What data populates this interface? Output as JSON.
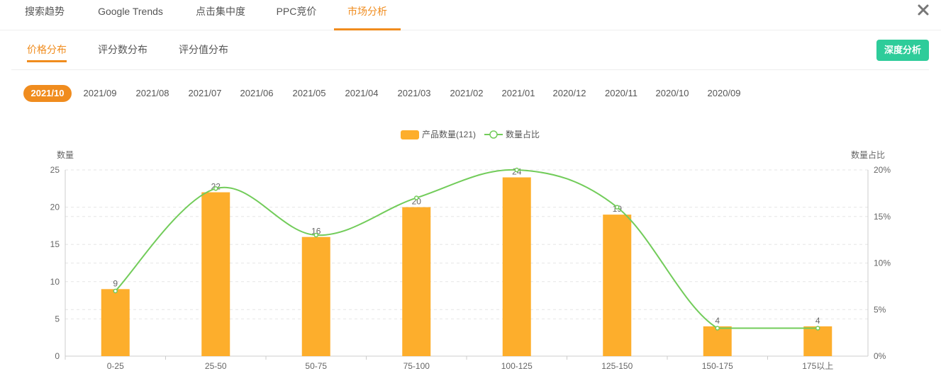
{
  "top_tabs": [
    {
      "label": "搜索趋势",
      "active": false
    },
    {
      "label": "Google Trends",
      "active": false
    },
    {
      "label": "点击集中度",
      "active": false
    },
    {
      "label": "PPC竞价",
      "active": false
    },
    {
      "label": "市场分析",
      "active": true
    }
  ],
  "close_icon": "close-icon",
  "sub_tabs": [
    {
      "label": "价格分布",
      "active": true
    },
    {
      "label": "评分数分布",
      "active": false
    },
    {
      "label": "评分值分布",
      "active": false
    }
  ],
  "deep_button": "深度分析",
  "months": [
    "2021/10",
    "2021/09",
    "2021/08",
    "2021/07",
    "2021/06",
    "2021/05",
    "2021/04",
    "2021/03",
    "2021/02",
    "2021/01",
    "2020/12",
    "2020/11",
    "2020/10",
    "2020/09"
  ],
  "active_month": "2021/10",
  "colors": {
    "accent": "#f08c1e",
    "bar": "#fdae2c",
    "line": "#72cc5a",
    "button": "#2ecc9a"
  },
  "chart_data": {
    "type": "bar",
    "categories": [
      "0-25",
      "25-50",
      "50-75",
      "75-100",
      "100-125",
      "125-150",
      "150-175",
      "175以上"
    ],
    "series": [
      {
        "name": "产品数量(121)",
        "type": "bar",
        "axis": "left",
        "values": [
          9,
          22,
          16,
          20,
          24,
          19,
          4,
          4
        ]
      },
      {
        "name": "数量占比",
        "type": "line",
        "axis": "right",
        "values": [
          7.0,
          18.0,
          13.0,
          17.0,
          20.0,
          16.0,
          3.0,
          3.0
        ]
      }
    ],
    "ylabel": "数量",
    "ylabel_right": "数量占比",
    "ylim": [
      0,
      25
    ],
    "yticks": [
      0,
      5,
      10,
      15,
      20,
      25
    ],
    "ylim_right": [
      0,
      20
    ],
    "yticks_right": [
      "0%",
      "5%",
      "10%",
      "15%",
      "20%"
    ],
    "grid": true,
    "legend": "top-center"
  }
}
